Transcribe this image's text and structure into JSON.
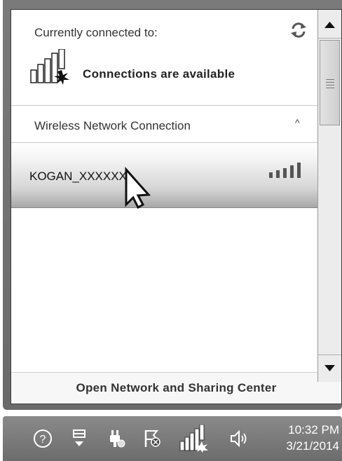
{
  "flyout": {
    "current_label": "Currently connected to:",
    "connection_status": "Connections are available",
    "section_label": "Wireless Network Connection",
    "collapse_glyph": "^",
    "network": {
      "ssid": "KOGAN_XXXXXX",
      "signal_strength": "5 of 5 bars",
      "icon": "wifi-signal-icon"
    },
    "footer_link": "Open Network and Sharing Center",
    "icons": {
      "refresh": "refresh-icon",
      "connection": "network-available-icon"
    }
  },
  "scrollbar": {
    "up": "scroll-up-arrow",
    "down": "scroll-down-arrow"
  },
  "taskbar": {
    "icons": [
      "help-icon",
      "show-hidden-icons",
      "power-plug-icon",
      "action-center-flag-icon",
      "network-icon",
      "volume-icon"
    ],
    "time": "10:32 PM",
    "date": "3/21/2014"
  },
  "colors": {
    "taskbar_bg": "#7a7a7a",
    "selected_row_gradient_end": "#a8a8a8"
  }
}
